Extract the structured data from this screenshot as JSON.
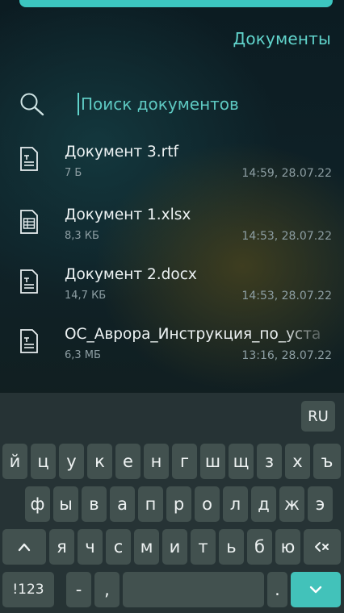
{
  "header": {
    "title": "Документы"
  },
  "search": {
    "placeholder": "Поиск документов"
  },
  "files": [
    {
      "name": "Документ 3.rtf",
      "size": "7 Б",
      "date": "14:59, 28.07.22",
      "icon": "text-document-icon"
    },
    {
      "name": "Документ 1.xlsx",
      "size": "8,3 КБ",
      "date": "14:53, 28.07.22",
      "icon": "spreadsheet-icon"
    },
    {
      "name": "Документ 2.docx",
      "size": "14,7 КБ",
      "date": "14:53, 28.07.22",
      "icon": "text-document-icon"
    },
    {
      "name": "ОС_Аврора_Инструкция_по_уста",
      "size": "6,3 МБ",
      "date": "13:16, 28.07.22",
      "icon": "text-document-icon"
    }
  ],
  "keyboard": {
    "language": "RU",
    "row1": [
      "й",
      "ц",
      "у",
      "к",
      "е",
      "н",
      "г",
      "ш",
      "щ",
      "з",
      "х",
      "ъ"
    ],
    "row2": [
      "ф",
      "ы",
      "в",
      "а",
      "п",
      "р",
      "о",
      "л",
      "д",
      "ж",
      "э"
    ],
    "row3": [
      "я",
      "ч",
      "с",
      "м",
      "и",
      "т",
      "ь",
      "б",
      "ю"
    ],
    "shift_icon": "shift-caret-icon",
    "backspace_icon": "backspace-icon",
    "symbols_label": "!123",
    "dash_label": "-",
    "comma_label": ",",
    "period_label": ".",
    "enter_icon": "chevron-down-icon"
  },
  "colors": {
    "accent": "#61d4cc",
    "enter": "#42c2ba",
    "key": "#42514f"
  }
}
